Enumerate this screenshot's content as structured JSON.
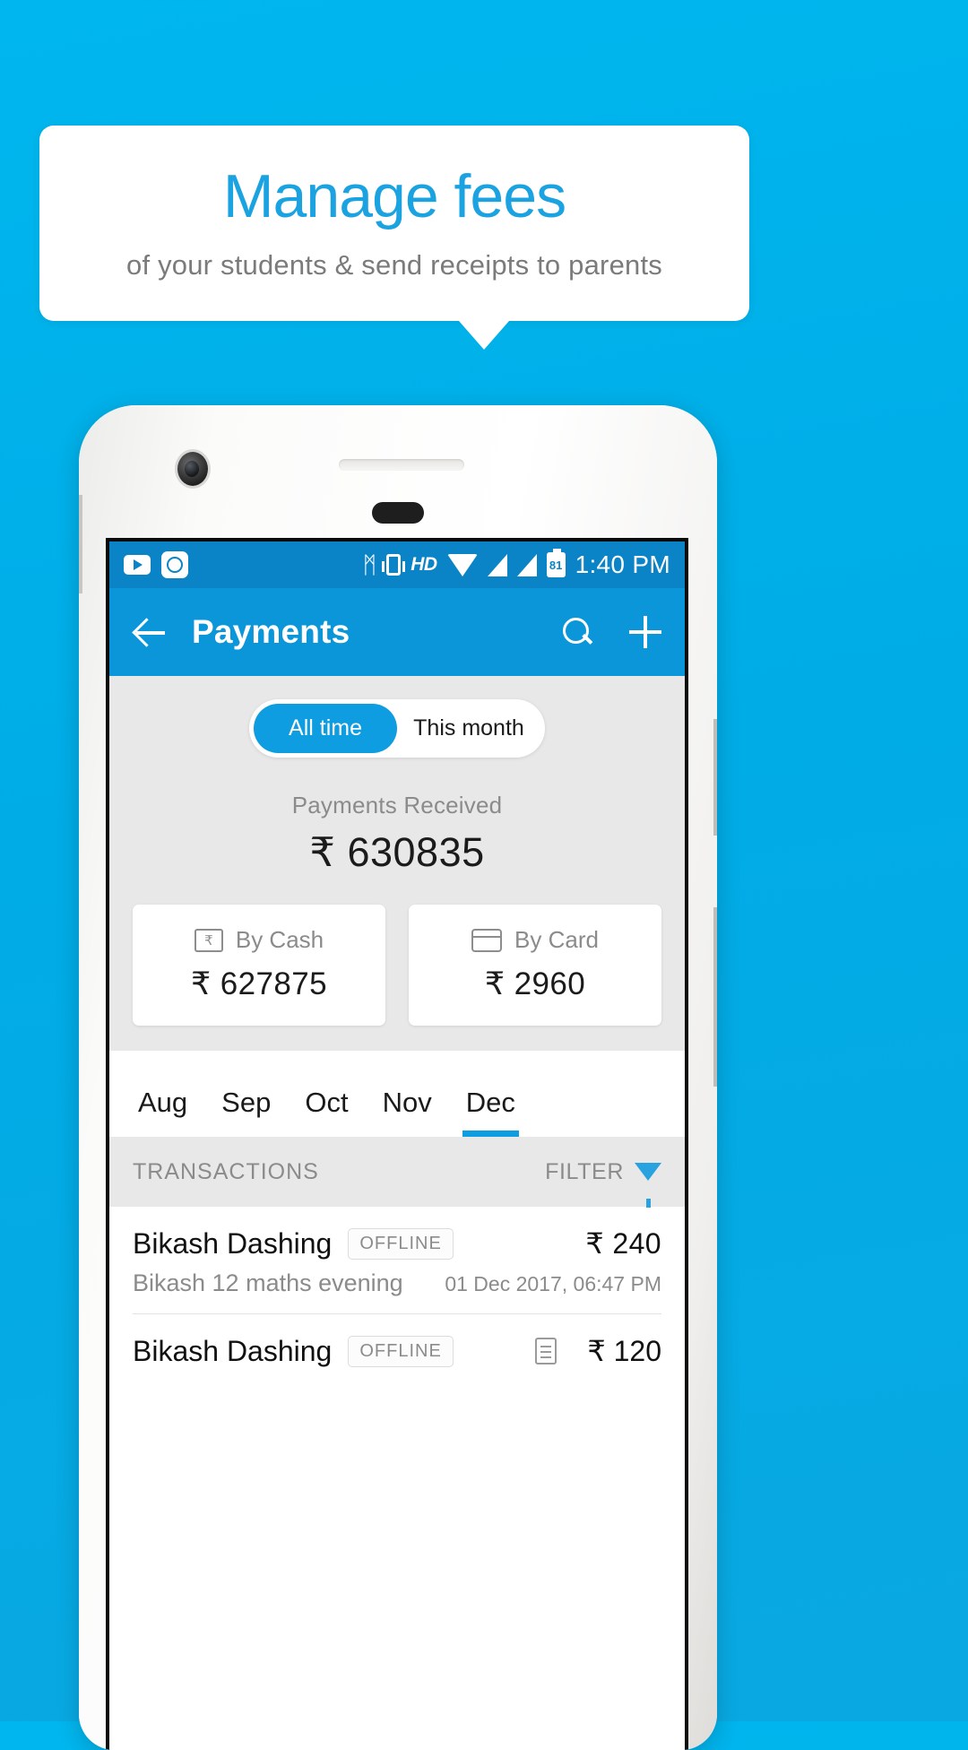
{
  "promo": {
    "title": "Manage fees",
    "subtitle": "of your students & send receipts to parents"
  },
  "statusbar": {
    "icons": [
      "youtube-icon",
      "camera-app-icon",
      "bluetooth-icon",
      "vibrate-icon",
      "hd-icon",
      "wifi-icon",
      "signal-icon",
      "signal-icon-2",
      "battery-icon"
    ],
    "bluetooth_glyph": "ᛗ",
    "hd_label": "HD",
    "battery_level": "81",
    "time": "1:40 PM"
  },
  "appbar": {
    "back_icon": "back-arrow-icon",
    "title": "Payments",
    "search_icon": "search-icon",
    "add_icon": "plus-icon"
  },
  "segments": {
    "options": [
      "All time",
      "This month"
    ],
    "selected": "All time"
  },
  "summary": {
    "received_label": "Payments Received",
    "received_value": "₹ 630835",
    "cards": [
      {
        "icon": "cash-icon",
        "label": "By Cash",
        "value": "₹ 627875"
      },
      {
        "icon": "credit-card-icon",
        "label": "By Card",
        "value": "₹ 2960"
      }
    ]
  },
  "months": {
    "items": [
      "Aug",
      "Sep",
      "Oct",
      "Nov",
      "Dec"
    ],
    "selected": "Dec"
  },
  "transactions_header": {
    "title": "TRANSACTIONS",
    "filter_label": "FILTER",
    "filter_icon": "funnel-icon",
    "filter_color": "#29a3e0"
  },
  "transactions": [
    {
      "name": "Bikash Dashing",
      "badge": "OFFLINE",
      "amount": "₹ 240",
      "description": "Bikash 12 maths evening",
      "date": "01 Dec 2017, 06:47 PM",
      "has_receipt": false
    },
    {
      "name": "Bikash Dashing",
      "badge": "OFFLINE",
      "amount": "₹ 120",
      "description": "",
      "date": "",
      "has_receipt": true
    }
  ],
  "colors": {
    "brand_blue": "#00ace6",
    "appbar_blue": "#0b96d9",
    "statusbar_blue": "#0b84c7",
    "accent": "#0d9de0",
    "title_blue": "#1aa3e0"
  }
}
